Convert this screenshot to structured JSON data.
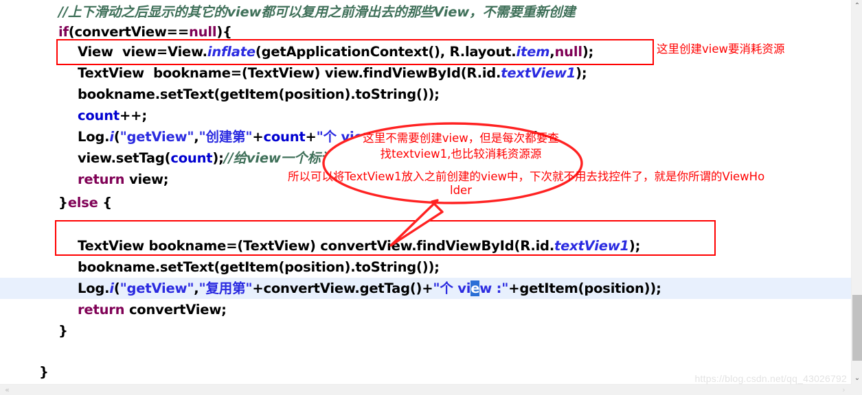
{
  "editor": {
    "background": "#ffffff",
    "current_line_highlight_color": "#e8f0fd",
    "selection_color": "#2a6fd6",
    "annotation_color": "#ff0000",
    "comment_color": "#3f7059",
    "keyword_color": "#7f0055",
    "string_color": "#2a2ae0",
    "field_color": "#0000c0"
  },
  "code_lines": [
    {
      "indent": 85,
      "text": "//上下滑动之后显示的其它的view都可以复用之前滑出去的那些View，不需要重新创建"
    },
    {
      "indent": 85,
      "text": "if(convertView==null){"
    },
    {
      "indent": 113,
      "text": "View  view=View.inflate(getApplicationContext(), R.layout.item,null);"
    },
    {
      "indent": 113,
      "text": "TextView  bookname=(TextView) view.findViewById(R.id.textView1);"
    },
    {
      "indent": 113,
      "text": "bookname.setText(getItem(position).toString());"
    },
    {
      "indent": 113,
      "text": "count++;"
    },
    {
      "indent": 113,
      "text": "Log.i(\"getView\",\"创建第\"+count+\"个 view :\"+getItem(position));"
    },
    {
      "indent": 113,
      "text": "view.setTag(count);//给view一个标记"
    },
    {
      "indent": 113,
      "text": "return view;"
    },
    {
      "indent": 85,
      "text": "}else {"
    },
    {
      "indent": 113,
      "text": "TextView bookname=(TextView) convertView.findViewById(R.id.textView1);"
    },
    {
      "indent": 113,
      "text": "bookname.setText(getItem(position).toString());"
    },
    {
      "indent": 113,
      "text": "Log.i(\"getView\",\"复用第\"+convertView.getTag()+\"个 view :\"+getItem(position));"
    },
    {
      "indent": 113,
      "text": "return convertView;"
    },
    {
      "indent": 85,
      "text": "}"
    },
    {
      "indent": 57,
      "text": "}"
    }
  ],
  "annotations": {
    "right_note": "这里创建view要消耗资源",
    "bubble": {
      "line1": "这里不需要创建view，但是每次都要查",
      "line2": "找textview1,也比较消耗资源源",
      "line3": "所以可以将TextView1放入之前创建的view中，下次就不用去找控件了，就是你所谓的ViewHo",
      "line4": "lder"
    }
  },
  "watermark": "https://blog.csdn.net/qq_43026792",
  "scrollbars": {
    "vertical_up": "⌃",
    "vertical_down": "⌄",
    "horizontal_left": "«",
    "horizontal_right": "›"
  }
}
